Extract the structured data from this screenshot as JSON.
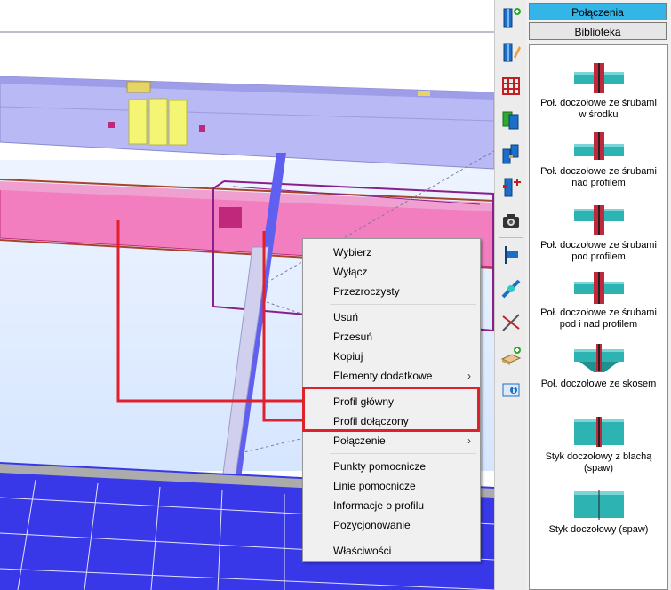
{
  "context_menu": {
    "items": [
      {
        "label": "Wybierz",
        "submenu": false
      },
      {
        "label": "Wyłącz",
        "submenu": false
      },
      {
        "label": "Przezroczysty",
        "submenu": false
      },
      {
        "label": "Usuń",
        "submenu": false
      },
      {
        "label": "Przesuń",
        "submenu": false
      },
      {
        "label": "Kopiuj",
        "submenu": false
      },
      {
        "label": "Elementy dodatkowe",
        "submenu": true
      },
      {
        "label": "Profil główny",
        "submenu": false
      },
      {
        "label": "Profil dołączony",
        "submenu": false
      },
      {
        "label": "Połączenie",
        "submenu": true
      },
      {
        "label": "Punkty pomocnicze",
        "submenu": false
      },
      {
        "label": "Linie pomocnicze",
        "submenu": false
      },
      {
        "label": "Informacje o profilu",
        "submenu": false
      },
      {
        "label": "Pozycjonowanie",
        "submenu": false
      },
      {
        "label": "Właściwości",
        "submenu": false
      }
    ],
    "submenu_arrow": "›"
  },
  "panel": {
    "tabs": [
      {
        "label": "Połączenia",
        "active": true
      },
      {
        "label": "Biblioteka",
        "active": false
      }
    ],
    "items": [
      {
        "label_lines": [
          "Poł. doczołowe ze śrubami",
          "w środku"
        ],
        "icon": "end-plate-bolts-middle-icon"
      },
      {
        "label_lines": [
          "Poł. doczołowe ze śrubami",
          "nad profilem"
        ],
        "icon": "end-plate-bolts-above-icon"
      },
      {
        "label_lines": [
          "Poł. doczołowe ze śrubami",
          "pod profilem"
        ],
        "icon": "end-plate-bolts-below-icon"
      },
      {
        "label_lines": [
          "Poł. doczołowe ze śrubami",
          "pod i nad profilem"
        ],
        "icon": "end-plate-bolts-both-icon"
      },
      {
        "label_lines": [
          "Poł. doczołowe ze skosem"
        ],
        "icon": "end-plate-haunch-icon"
      },
      {
        "label_lines": [
          "Styk doczołowy z blachą",
          "(spaw)"
        ],
        "icon": "butt-joint-plate-weld-icon"
      },
      {
        "label_lines": [
          "Styk doczołowy (spaw)"
        ],
        "icon": "butt-joint-weld-icon"
      }
    ]
  },
  "toolbar": {
    "buttons": [
      "add-profile-icon",
      "edit-profile-icon",
      "grid-icon",
      "copy-profile-icon",
      "connect-profiles-icon",
      "add-point-icon",
      "camera-icon",
      "align-icon",
      "cross-section-icon",
      "cut-icon",
      "add-plate-icon",
      "info-icon"
    ]
  },
  "colors": {
    "highlight_red": "#e0202a",
    "tab_active": "#33b5e8",
    "beam_pink": "#f27ec0",
    "beam_lavender": "#b9b9f5",
    "floor_blue": "#3838e8"
  }
}
